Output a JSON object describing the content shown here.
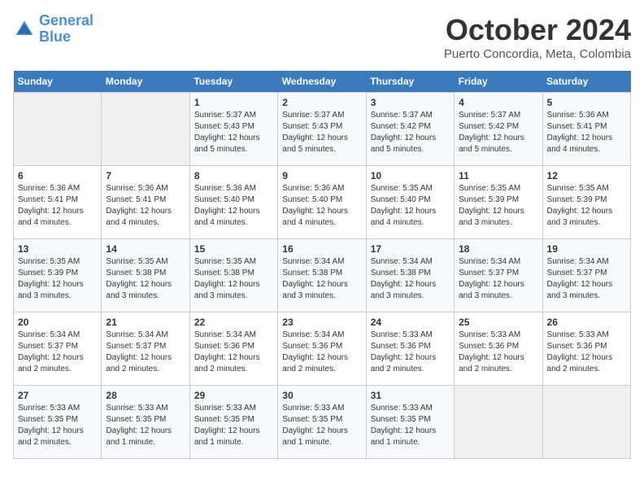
{
  "header": {
    "logo_general": "General",
    "logo_blue": "Blue",
    "month": "October 2024",
    "location": "Puerto Concordia, Meta, Colombia"
  },
  "days_of_week": [
    "Sunday",
    "Monday",
    "Tuesday",
    "Wednesday",
    "Thursday",
    "Friday",
    "Saturday"
  ],
  "weeks": [
    [
      {
        "day": "",
        "info": ""
      },
      {
        "day": "",
        "info": ""
      },
      {
        "day": "1",
        "info": "Sunrise: 5:37 AM\nSunset: 5:43 PM\nDaylight: 12 hours\nand 5 minutes."
      },
      {
        "day": "2",
        "info": "Sunrise: 5:37 AM\nSunset: 5:43 PM\nDaylight: 12 hours\nand 5 minutes."
      },
      {
        "day": "3",
        "info": "Sunrise: 5:37 AM\nSunset: 5:42 PM\nDaylight: 12 hours\nand 5 minutes."
      },
      {
        "day": "4",
        "info": "Sunrise: 5:37 AM\nSunset: 5:42 PM\nDaylight: 12 hours\nand 5 minutes."
      },
      {
        "day": "5",
        "info": "Sunrise: 5:36 AM\nSunset: 5:41 PM\nDaylight: 12 hours\nand 4 minutes."
      }
    ],
    [
      {
        "day": "6",
        "info": "Sunrise: 5:36 AM\nSunset: 5:41 PM\nDaylight: 12 hours\nand 4 minutes."
      },
      {
        "day": "7",
        "info": "Sunrise: 5:36 AM\nSunset: 5:41 PM\nDaylight: 12 hours\nand 4 minutes."
      },
      {
        "day": "8",
        "info": "Sunrise: 5:36 AM\nSunset: 5:40 PM\nDaylight: 12 hours\nand 4 minutes."
      },
      {
        "day": "9",
        "info": "Sunrise: 5:36 AM\nSunset: 5:40 PM\nDaylight: 12 hours\nand 4 minutes."
      },
      {
        "day": "10",
        "info": "Sunrise: 5:35 AM\nSunset: 5:40 PM\nDaylight: 12 hours\nand 4 minutes."
      },
      {
        "day": "11",
        "info": "Sunrise: 5:35 AM\nSunset: 5:39 PM\nDaylight: 12 hours\nand 3 minutes."
      },
      {
        "day": "12",
        "info": "Sunrise: 5:35 AM\nSunset: 5:39 PM\nDaylight: 12 hours\nand 3 minutes."
      }
    ],
    [
      {
        "day": "13",
        "info": "Sunrise: 5:35 AM\nSunset: 5:39 PM\nDaylight: 12 hours\nand 3 minutes."
      },
      {
        "day": "14",
        "info": "Sunrise: 5:35 AM\nSunset: 5:38 PM\nDaylight: 12 hours\nand 3 minutes."
      },
      {
        "day": "15",
        "info": "Sunrise: 5:35 AM\nSunset: 5:38 PM\nDaylight: 12 hours\nand 3 minutes."
      },
      {
        "day": "16",
        "info": "Sunrise: 5:34 AM\nSunset: 5:38 PM\nDaylight: 12 hours\nand 3 minutes."
      },
      {
        "day": "17",
        "info": "Sunrise: 5:34 AM\nSunset: 5:38 PM\nDaylight: 12 hours\nand 3 minutes."
      },
      {
        "day": "18",
        "info": "Sunrise: 5:34 AM\nSunset: 5:37 PM\nDaylight: 12 hours\nand 3 minutes."
      },
      {
        "day": "19",
        "info": "Sunrise: 5:34 AM\nSunset: 5:37 PM\nDaylight: 12 hours\nand 3 minutes."
      }
    ],
    [
      {
        "day": "20",
        "info": "Sunrise: 5:34 AM\nSunset: 5:37 PM\nDaylight: 12 hours\nand 2 minutes."
      },
      {
        "day": "21",
        "info": "Sunrise: 5:34 AM\nSunset: 5:37 PM\nDaylight: 12 hours\nand 2 minutes."
      },
      {
        "day": "22",
        "info": "Sunrise: 5:34 AM\nSunset: 5:36 PM\nDaylight: 12 hours\nand 2 minutes."
      },
      {
        "day": "23",
        "info": "Sunrise: 5:34 AM\nSunset: 5:36 PM\nDaylight: 12 hours\nand 2 minutes."
      },
      {
        "day": "24",
        "info": "Sunrise: 5:33 AM\nSunset: 5:36 PM\nDaylight: 12 hours\nand 2 minutes."
      },
      {
        "day": "25",
        "info": "Sunrise: 5:33 AM\nSunset: 5:36 PM\nDaylight: 12 hours\nand 2 minutes."
      },
      {
        "day": "26",
        "info": "Sunrise: 5:33 AM\nSunset: 5:36 PM\nDaylight: 12 hours\nand 2 minutes."
      }
    ],
    [
      {
        "day": "27",
        "info": "Sunrise: 5:33 AM\nSunset: 5:35 PM\nDaylight: 12 hours\nand 2 minutes."
      },
      {
        "day": "28",
        "info": "Sunrise: 5:33 AM\nSunset: 5:35 PM\nDaylight: 12 hours\nand 1 minute."
      },
      {
        "day": "29",
        "info": "Sunrise: 5:33 AM\nSunset: 5:35 PM\nDaylight: 12 hours\nand 1 minute."
      },
      {
        "day": "30",
        "info": "Sunrise: 5:33 AM\nSunset: 5:35 PM\nDaylight: 12 hours\nand 1 minute."
      },
      {
        "day": "31",
        "info": "Sunrise: 5:33 AM\nSunset: 5:35 PM\nDaylight: 12 hours\nand 1 minute."
      },
      {
        "day": "",
        "info": ""
      },
      {
        "day": "",
        "info": ""
      }
    ]
  ]
}
